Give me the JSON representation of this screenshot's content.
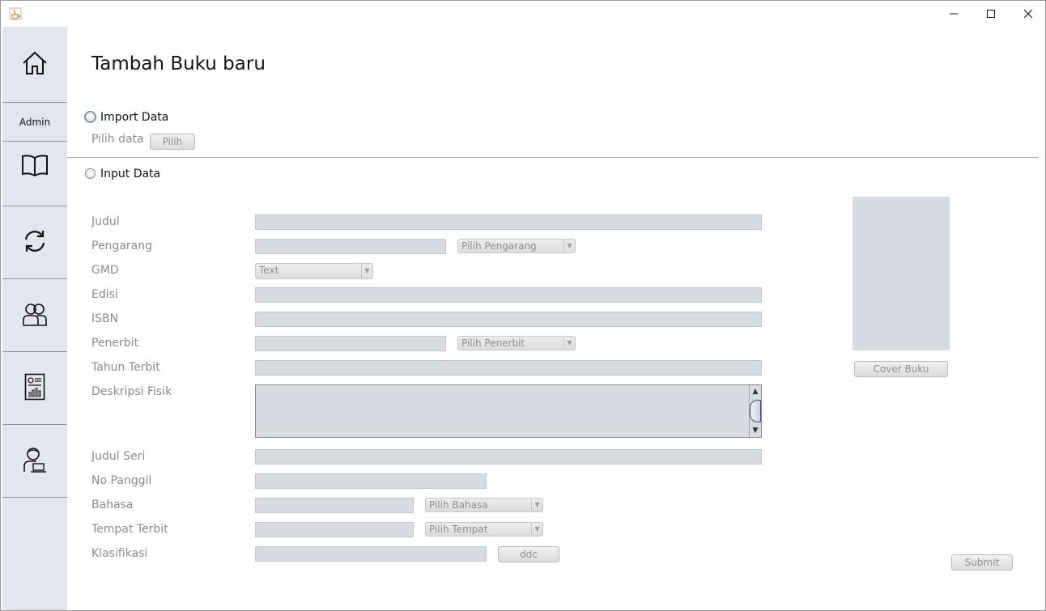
{
  "window": {
    "app_icon": "java-cup-icon",
    "controls": [
      "minimize-icon",
      "maximize-icon",
      "close-icon"
    ]
  },
  "sidebar": {
    "admin_label": "Admin",
    "items": [
      "home-icon",
      "book-icon",
      "refresh-icon",
      "members-icon",
      "report-icon",
      "user-laptop-icon"
    ]
  },
  "page": {
    "title": "Tambah Buku baru"
  },
  "import": {
    "radio_label": "Import Data",
    "pick_label": "Pilih data",
    "pick_button": "Pilih"
  },
  "input": {
    "radio_label": "Input Data"
  },
  "form": {
    "judul": "Judul",
    "pengarang": "Pengarang",
    "pengarang_combo": "Pilih Pengarang",
    "gmd": "GMD",
    "gmd_combo": "Text",
    "edisi": "Edisi",
    "isbn": "ISBN",
    "penerbit": "Penerbit",
    "penerbit_combo": "Pilih Penerbit",
    "tahun_terbit": "Tahun Terbit",
    "deskripsi_fisik": "Deskripsi Fisik",
    "judul_seri": "Judul Seri",
    "no_panggil": "No Panggil",
    "bahasa": "Bahasa",
    "bahasa_combo": "Pilih Bahasa",
    "tempat_terbit": "Tempat Terbit",
    "tempat_combo": "Pilih Tempat",
    "klasifikasi": "Klasifikasi",
    "ddc_button": "ddc"
  },
  "cover": {
    "button": "Cover Buku"
  },
  "submit": {
    "button": "Submit"
  }
}
